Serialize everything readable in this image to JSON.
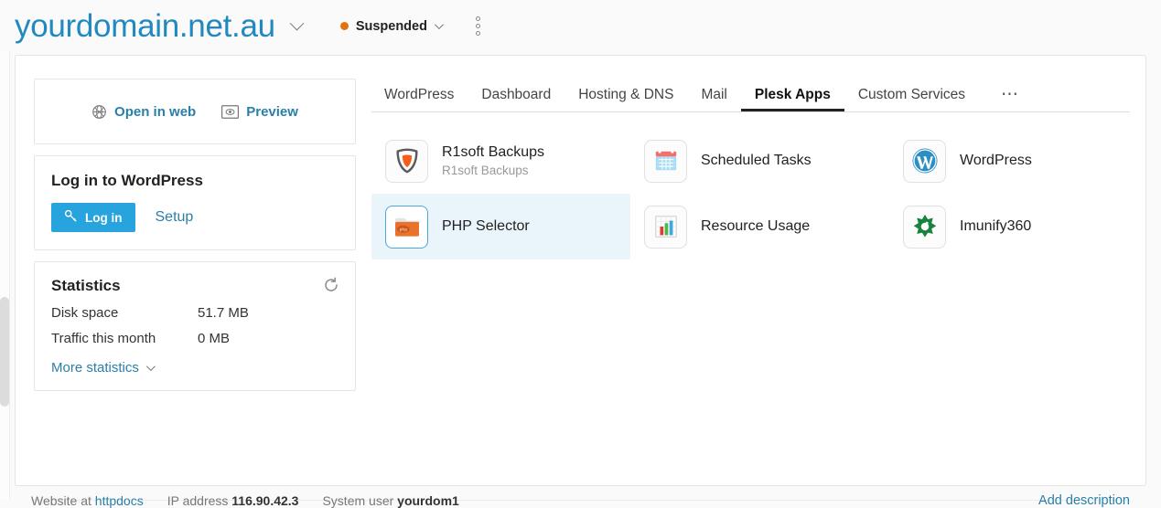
{
  "header": {
    "domain": "yourdomain.net.au",
    "domain_chevron_icon": "chevron-down-icon",
    "status_label": "Suspended",
    "status_color": "#e2710f",
    "status_chevron_icon": "chevron-down-icon",
    "kebab_icon": "more-vertical-icon"
  },
  "left": {
    "actions": [
      {
        "label": "Open in web",
        "icon": "globe-icon"
      },
      {
        "label": "Preview",
        "icon": "preview-screen-icon"
      }
    ],
    "login_panel": {
      "title": "Log in to WordPress",
      "button_label": "Log in",
      "button_icon": "key-icon",
      "button_color": "#27a3dd",
      "setup_label": "Setup"
    },
    "stats_panel": {
      "title": "Statistics",
      "refresh_icon": "refresh-icon",
      "rows": [
        {
          "label": "Disk space",
          "value": "51.7 MB"
        },
        {
          "label": "Traffic this month",
          "value": "0 MB"
        }
      ],
      "more_label": "More statistics",
      "more_chevron_icon": "chevron-down-icon"
    }
  },
  "tabs": [
    {
      "label": "WordPress",
      "active": false
    },
    {
      "label": "Dashboard",
      "active": false
    },
    {
      "label": "Hosting & DNS",
      "active": false
    },
    {
      "label": "Mail",
      "active": false
    },
    {
      "label": "Plesk Apps",
      "active": true
    },
    {
      "label": "Custom Services",
      "active": false
    }
  ],
  "tab_overflow_label": "⋯",
  "apps": [
    {
      "title": "R1soft Backups",
      "subtitle": "R1soft Backups",
      "icon": "r1soft-shield-icon",
      "selected": false
    },
    {
      "title": "Scheduled Tasks",
      "subtitle": "",
      "icon": "calendar-icon",
      "selected": false
    },
    {
      "title": "WordPress",
      "subtitle": "",
      "icon": "wordpress-icon",
      "selected": false
    },
    {
      "title": "PHP Selector",
      "subtitle": "",
      "icon": "php-folder-icon",
      "selected": true
    },
    {
      "title": "Resource Usage",
      "subtitle": "",
      "icon": "bar-chart-icon",
      "selected": false
    },
    {
      "title": "Imunify360",
      "subtitle": "",
      "icon": "imunify360-icon",
      "selected": false
    }
  ],
  "footer": {
    "website_prefix": "Website at",
    "website_value": "httpdocs",
    "ip_prefix": "IP address",
    "ip_value": "116.90.42.3",
    "user_prefix": "System user",
    "user_value": "yourdom1",
    "add_description_label": "Add description"
  }
}
